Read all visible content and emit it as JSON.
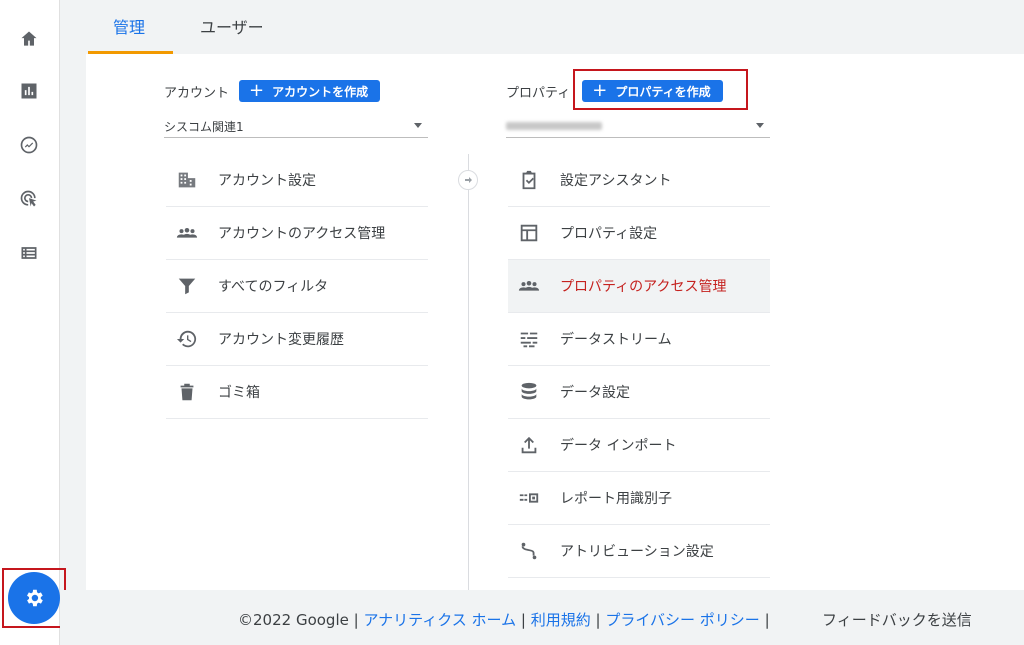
{
  "tabs": [
    {
      "label": "管理"
    },
    {
      "label": "ユーザー"
    }
  ],
  "account": {
    "label": "アカウント",
    "create_button": "アカウントを作成",
    "selected": "シスコム関連1",
    "items": [
      {
        "label": "アカウント設定",
        "icon": "building-icon"
      },
      {
        "label": "アカウントのアクセス管理",
        "icon": "people-icon"
      },
      {
        "label": "すべてのフィルタ",
        "icon": "filter-icon"
      },
      {
        "label": "アカウント変更履歴",
        "icon": "history-icon"
      },
      {
        "label": "ゴミ箱",
        "icon": "trash-icon"
      }
    ]
  },
  "property": {
    "label": "プロパティ",
    "create_button": "プロパティを作成",
    "items": [
      {
        "label": "設定アシスタント",
        "icon": "checklist-icon"
      },
      {
        "label": "プロパティ設定",
        "icon": "property-settings-icon"
      },
      {
        "label": "プロパティのアクセス管理",
        "icon": "people-icon"
      },
      {
        "label": "データストリーム",
        "icon": "stream-icon"
      },
      {
        "label": "データ設定",
        "icon": "database-icon"
      },
      {
        "label": "データ インポート",
        "icon": "upload-icon"
      },
      {
        "label": "レポート用識別子",
        "icon": "identifier-icon"
      },
      {
        "label": "アトリビューション設定",
        "icon": "attribution-icon"
      }
    ]
  },
  "footer": {
    "copyright": "©2022 Google",
    "link_home": "アナリティクス ホーム",
    "link_terms": "利用規約",
    "link_privacy": "プライバシー ポリシー",
    "feedback": "フィードバックを送信"
  },
  "colors": {
    "accent": "#1a73e8",
    "highlight": "#c5161d",
    "tab_underline": "#f29900",
    "selected_text": "#c5221f"
  }
}
